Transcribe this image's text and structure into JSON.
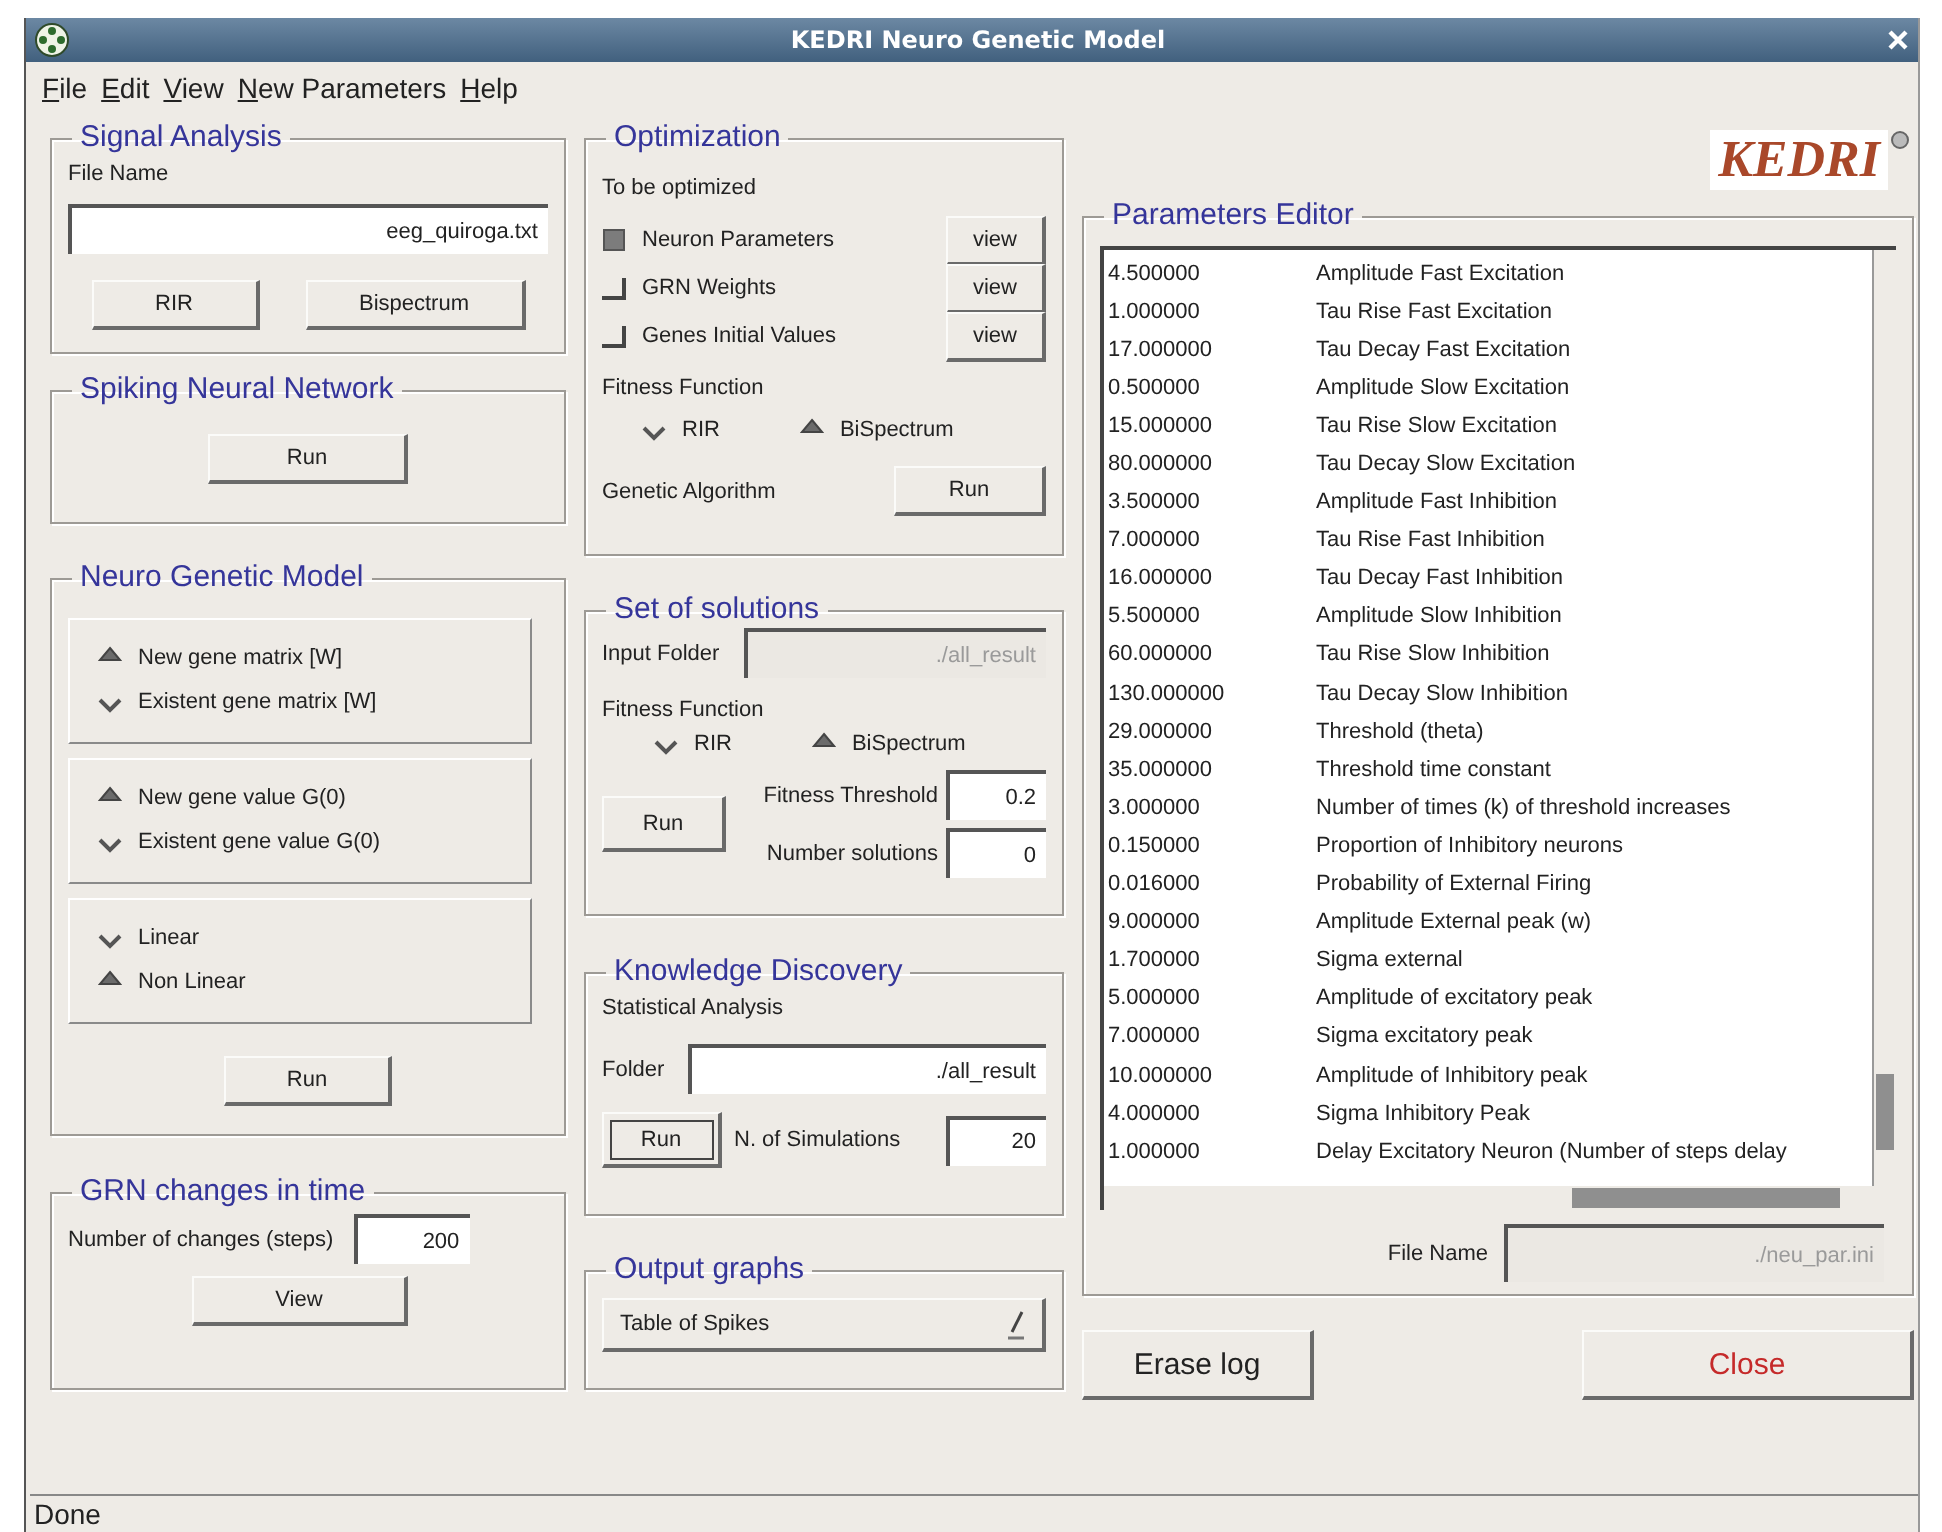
{
  "window": {
    "title": "KEDRI Neuro Genetic Model"
  },
  "menu": [
    "File",
    "Edit",
    "View",
    "New Parameters",
    "Help"
  ],
  "logo": "KEDRI",
  "signal_analysis": {
    "title": "Signal Analysis",
    "file_label": "File Name",
    "file_value": "eeg_quiroga.txt",
    "buttons": [
      "RIR",
      "Bispectrum"
    ]
  },
  "spiking": {
    "title": "Spiking Neural Network",
    "button": "Run"
  },
  "neuro_genetic": {
    "title": "Neuro Genetic Model",
    "option_groups": [
      [
        {
          "label": "New gene matrix [W]",
          "selected": true
        },
        {
          "label": "Existent gene matrix [W]",
          "selected": false
        }
      ],
      [
        {
          "label": "New gene value G(0)",
          "selected": true
        },
        {
          "label": "Existent gene value G(0)",
          "selected": false
        }
      ],
      [
        {
          "label": "Linear",
          "selected": false
        },
        {
          "label": "Non Linear",
          "selected": true
        }
      ]
    ],
    "button": "Run"
  },
  "grn_changes": {
    "title": "GRN changes in time",
    "label": "Number of changes (steps)",
    "value": "200",
    "button": "View"
  },
  "optimization": {
    "title": "Optimization",
    "subtitle": "To be optimized",
    "targets": [
      {
        "label": "Neuron Parameters",
        "checked": true,
        "button": "view"
      },
      {
        "label": "GRN Weights",
        "checked": false,
        "button": "view"
      },
      {
        "label": "Genes Initial Values",
        "checked": false,
        "button": "view"
      }
    ],
    "fitness_label": "Fitness Function",
    "fitness_options": [
      {
        "label": "RIR",
        "selected": false
      },
      {
        "label": "BiSpectrum",
        "selected": true
      }
    ],
    "ga_label": "Genetic Algorithm",
    "ga_button": "Run"
  },
  "solutions": {
    "title": "Set of solutions",
    "folder_label": "Input Folder",
    "folder_value": "./all_result",
    "folder_disabled": true,
    "fitness_label": "Fitness Function",
    "fitness_options": [
      {
        "label": "RIR",
        "selected": false
      },
      {
        "label": "BiSpectrum",
        "selected": true
      }
    ],
    "threshold_label": "Fitness Threshold",
    "threshold_value": "0.2",
    "count_label": "Number solutions",
    "count_value": "0",
    "button": "Run"
  },
  "knowledge": {
    "title": "Knowledge Discovery",
    "subtitle": "Statistical Analysis",
    "folder_label": "Folder",
    "folder_value": "./all_result",
    "button": "Run",
    "button_focused": true,
    "sims_label": "N. of Simulations",
    "sims_value": "20"
  },
  "output_graphs": {
    "title": "Output graphs",
    "selection": "Table of Spikes"
  },
  "parameters_editor": {
    "title": "Parameters Editor",
    "rows": [
      {
        "value": "4.500000",
        "name": "Amplitude Fast Excitation"
      },
      {
        "value": "1.000000",
        "name": "Tau Rise Fast Excitation"
      },
      {
        "value": "17.000000",
        "name": "Tau Decay Fast Excitation"
      },
      {
        "value": "0.500000",
        "name": "Amplitude Slow Excitation"
      },
      {
        "value": "15.000000",
        "name": "Tau Rise Slow Excitation"
      },
      {
        "value": "80.000000",
        "name": "Tau Decay Slow Excitation"
      },
      {
        "value": "3.500000",
        "name": "Amplitude Fast Inhibition"
      },
      {
        "value": "7.000000",
        "name": "Tau Rise Fast Inhibition"
      },
      {
        "value": "16.000000",
        "name": "Tau Decay Fast Inhibition"
      },
      {
        "value": "5.500000",
        "name": "Amplitude Slow Inhibition"
      },
      {
        "value": "60.000000",
        "name": "Tau Rise Slow Inhibition"
      },
      {
        "value": "130.000000",
        "name": "Tau Decay Slow Inhibition"
      },
      {
        "value": "29.000000",
        "name": "Threshold (theta)"
      },
      {
        "value": "35.000000",
        "name": "Threshold time constant"
      },
      {
        "value": "3.000000",
        "name": "Number of times (k) of threshold increases"
      },
      {
        "value": "0.150000",
        "name": "Proportion of Inhibitory neurons"
      },
      {
        "value": "0.016000",
        "name": "Probability of External Firing"
      },
      {
        "value": "9.000000",
        "name": "Amplitude External peak (w)"
      },
      {
        "value": "1.700000",
        "name": "Sigma external"
      },
      {
        "value": "5.000000",
        "name": "Amplitude of excitatory peak"
      },
      {
        "value": "7.000000",
        "name": "Sigma excitatory peak"
      },
      {
        "value": "10.000000",
        "name": "Amplitude of Inhibitory peak"
      },
      {
        "value": "4.000000",
        "name": "Sigma Inhibitory Peak"
      },
      {
        "value": "1.000000",
        "name": "Delay Excitatory Neuron (Number of steps delay"
      }
    ],
    "file_label": "File Name",
    "file_value": "./neu_par.ini",
    "file_disabled": true
  },
  "buttons": [
    {
      "label": "Erase log",
      "kind": "normal"
    },
    {
      "label": "Close",
      "kind": "danger"
    }
  ],
  "status_bar": "Done"
}
